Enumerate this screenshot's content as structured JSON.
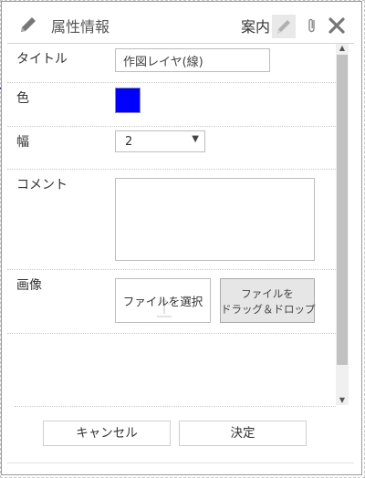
{
  "header": {
    "title": "属性情報",
    "guide_label": "案内",
    "icons": [
      "edit-icon",
      "pencil-icon",
      "paperclip-icon",
      "close-icon"
    ]
  },
  "form": {
    "title": {
      "label": "タイトル",
      "value": "作図レイヤ(線)"
    },
    "color": {
      "label": "色",
      "value": "#0000ff"
    },
    "width": {
      "label": "幅",
      "selected": "2"
    },
    "comment": {
      "label": "コメント",
      "value": ""
    },
    "image": {
      "label": "画像",
      "select_button": "ファイルを選択",
      "drop_line1": "ファイルを",
      "drop_line2": "ドラッグ＆ドロップ"
    }
  },
  "footer": {
    "cancel_label": "キャンセル",
    "ok_label": "決定"
  },
  "colors": {
    "accent_blue": "#0000ff",
    "scroll_thumb": "#c1c1c1",
    "drop_zone_bg": "#e6e6e6"
  }
}
